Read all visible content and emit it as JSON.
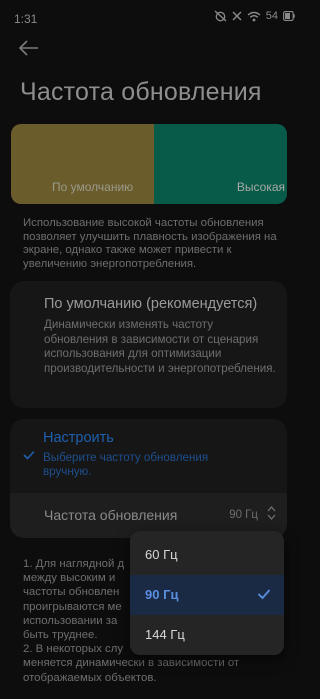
{
  "status_bar": {
    "time": "1:31",
    "battery": "54",
    "icons": [
      "no-alarm-icon",
      "x-icon",
      "wifi-icon",
      "battery-icon"
    ]
  },
  "header": {
    "back_icon": "back-arrow-icon",
    "title": "Частота обновления"
  },
  "preview": {
    "default_label": "По умолчанию",
    "high_label": "Высокая",
    "default_color": "#6b5c2c",
    "high_color": "#075b48"
  },
  "description": "Использование высокой частоты обновления позволяет улучшить плавность изображения на экране, однако также может привести к увеличению энергопотребления.",
  "options": {
    "default": {
      "title": "По умолчанию (рекомендуется)",
      "description": "Динамически изменять частоту обновления в зависимости от сценария использования для оптимизации производительности и энергопотребления."
    },
    "custom": {
      "title": "Настроить",
      "subtitle": "Выберите частоту обновления вручную.",
      "selected": true,
      "accent_color": "#1e5fae"
    }
  },
  "rate_setting": {
    "label": "Частота обновления",
    "value": "90 Гц"
  },
  "footnote": {
    "line1": "1. Для наглядной д",
    "line2": "между высоким и",
    "line3": "частоты обновлен",
    "line4": "проигрываются ме",
    "line5": "использовании за",
    "line6": "быть труднее.",
    "line7": "2. В некоторых слу",
    "line8": "меняется динамически в зависимости от",
    "line9": "отображаемых объектов."
  },
  "dropdown": {
    "options": [
      {
        "label": "60 Гц",
        "selected": false
      },
      {
        "label": "90 Гц",
        "selected": true
      },
      {
        "label": "144 Гц",
        "selected": false
      }
    ]
  }
}
